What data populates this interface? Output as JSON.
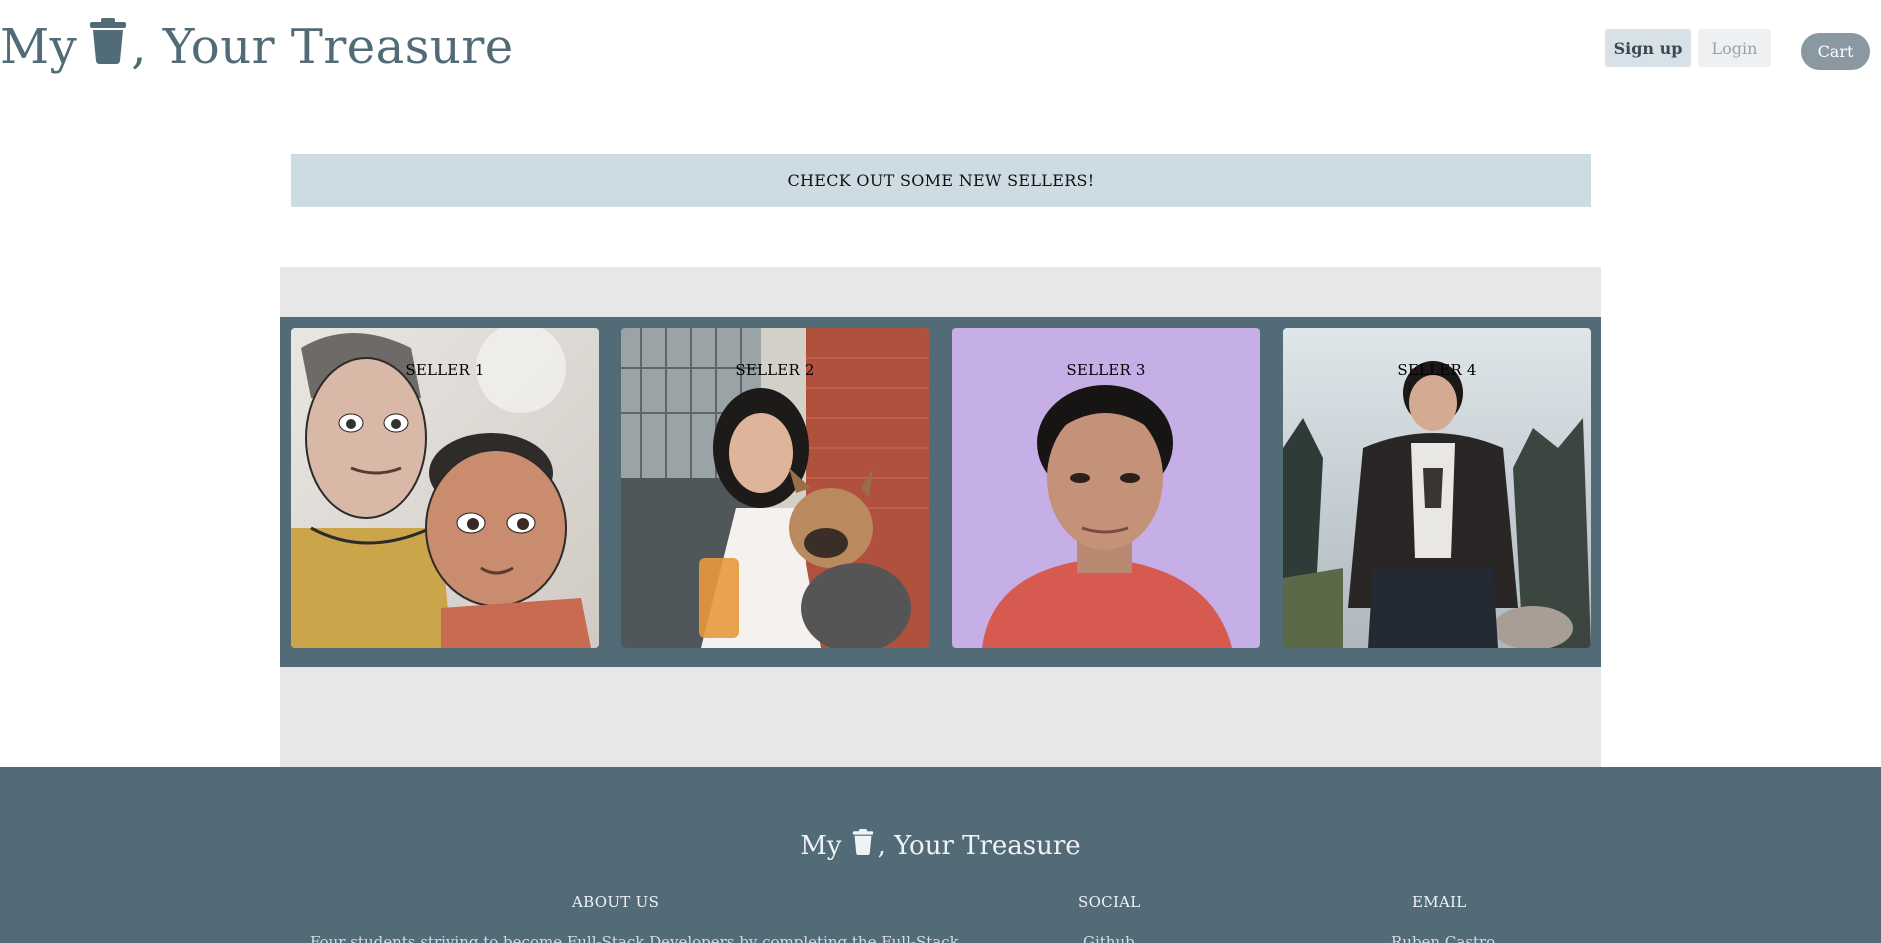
{
  "header": {
    "brand_prefix": "My",
    "brand_suffix": ", Your Treasure",
    "brand_icon": "trash-icon",
    "signup_label": "Sign up",
    "login_label": "Login",
    "cart_label": "Cart"
  },
  "banner": {
    "text": "CHECK OUT SOME NEW SELLERS!"
  },
  "sellers": [
    {
      "label": "SELLER 1"
    },
    {
      "label": "SELLER 2"
    },
    {
      "label": "SELLER 3"
    },
    {
      "label": "SELLER 4"
    }
  ],
  "footer": {
    "brand_prefix": "My",
    "brand_suffix": ", Your Treasure",
    "about_title": "ABOUT US",
    "about_text": "Four students striving to become Full-Stack Developers by completing the Full-Stack",
    "social_title": "SOCIAL",
    "social_text": "Github",
    "email_title": "EMAIL",
    "email_text": "Ruben Castro"
  },
  "colors": {
    "brand": "#516b77",
    "strip": "#536a77",
    "banner": "#cddbe2",
    "footer": "#536a77"
  }
}
